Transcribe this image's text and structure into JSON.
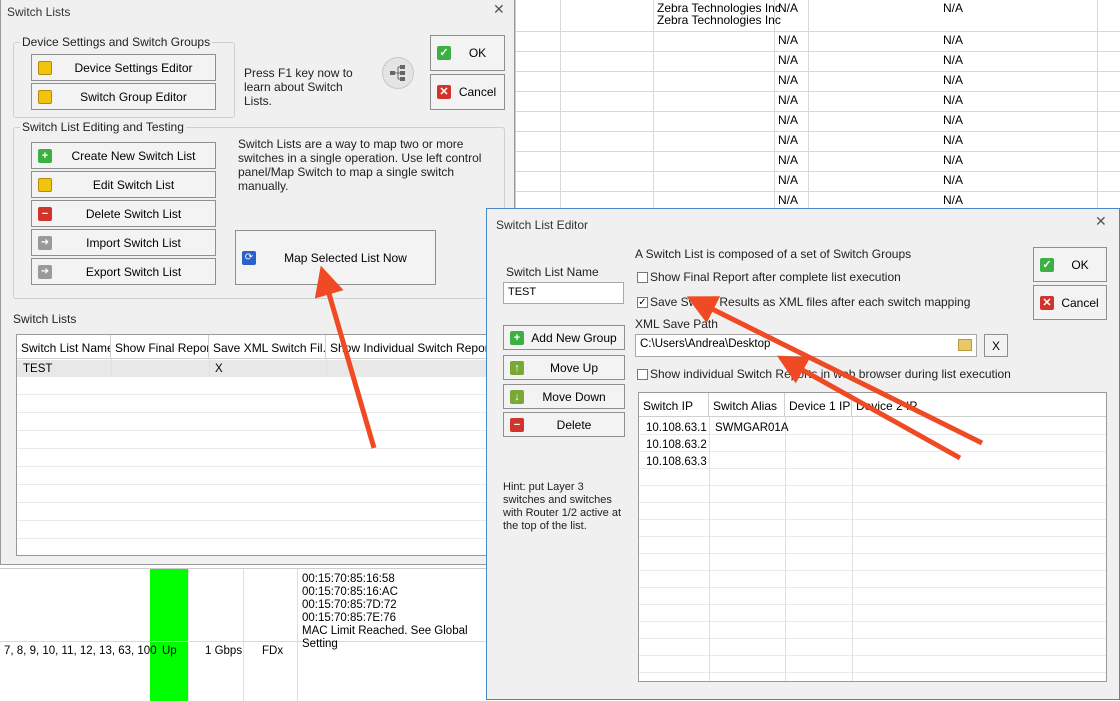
{
  "bg_table": {
    "rows": [
      {
        "company": "Zebra Technologies Inc\nZebra Technologies Inc",
        "a": "N/A",
        "b": "N/A"
      },
      {
        "company": "",
        "a": "N/A",
        "b": "N/A"
      },
      {
        "company": "",
        "a": "N/A",
        "b": "N/A"
      },
      {
        "company": "",
        "a": "N/A",
        "b": "N/A"
      },
      {
        "company": "",
        "a": "N/A",
        "b": "N/A"
      },
      {
        "company": "",
        "a": "N/A",
        "b": "N/A"
      },
      {
        "company": "",
        "a": "N/A",
        "b": "N/A"
      },
      {
        "company": "",
        "a": "N/A",
        "b": "N/A"
      },
      {
        "company": "",
        "a": "N/A",
        "b": "N/A"
      },
      {
        "company": "",
        "a": "N/A",
        "b": "N/A"
      }
    ]
  },
  "bottom_bg": {
    "macs": [
      "00:15:70:85:16:58",
      "00:15:70:85:16:AC",
      "00:15:70:85:7D:72",
      "00:15:70:85:7E:76",
      "MAC Limit Reached. See Global Setting"
    ],
    "ports": "7, 8, 9, 10, 11, 12, 13, 63, 100",
    "status": "Up",
    "speed": "1 Gbps",
    "duplex": "FDx",
    "status_color": "#00ff00"
  },
  "switch_lists": {
    "title": "Switch Lists",
    "group1_label": "Device Settings and Switch Groups",
    "device_settings_editor": "Device Settings Editor",
    "switch_group_editor": "Switch Group Editor",
    "f1_hint": "Press F1 key now to learn about Switch Lists.",
    "ok": "OK",
    "cancel": "Cancel",
    "group2_label": "Switch List Editing and Testing",
    "description": "Switch Lists are a way to map two or more switches in a single operation. Use left control panel/Map Switch to map a single switch manually.",
    "create": "Create New Switch List",
    "edit": "Edit Switch List",
    "delete": "Delete Switch List",
    "import": "Import Switch List",
    "export": "Export Switch List",
    "map_now": "Map Selected List Now",
    "lists_label": "Switch Lists",
    "columns": [
      "Switch List Name",
      "Show Final Report",
      "Save XML Switch Fil...",
      "Show Individual Switch Reports"
    ],
    "rows": [
      {
        "name": "TEST",
        "final": "",
        "xml": "X",
        "individual": ""
      }
    ]
  },
  "editor": {
    "title": "Switch List Editor",
    "name_label": "Switch List Name",
    "name_value": "TEST",
    "add_group": "Add New Group",
    "move_up": "Move Up",
    "move_down": "Move Down",
    "delete": "Delete",
    "hint": "Hint: put Layer 3 switches and switches with Router 1/2 active at the top of the list.",
    "composed": "A Switch List is composed of a set of Switch Groups",
    "opt_final": "Show Final Report after complete list execution",
    "opt_save": "Save Switch Results as XML files after each switch mapping",
    "xml_label": "XML Save Path",
    "xml_path": "C:\\Users\\Andrea\\Desktop",
    "clear_x": "X",
    "opt_individual": "Show individual Switch Reports in web browser during list execution",
    "ok": "OK",
    "cancel": "Cancel",
    "columns": [
      "Switch IP",
      "Switch Alias",
      "Device 1 IP",
      "Device 2 IP"
    ],
    "rows": [
      {
        "ip": "10.108.63.1",
        "alias": "SWMGAR01A"
      },
      {
        "ip": "10.108.63.2",
        "alias": ""
      },
      {
        "ip": "10.108.63.3",
        "alias": ""
      }
    ]
  },
  "annotation_color": "#f04a24"
}
